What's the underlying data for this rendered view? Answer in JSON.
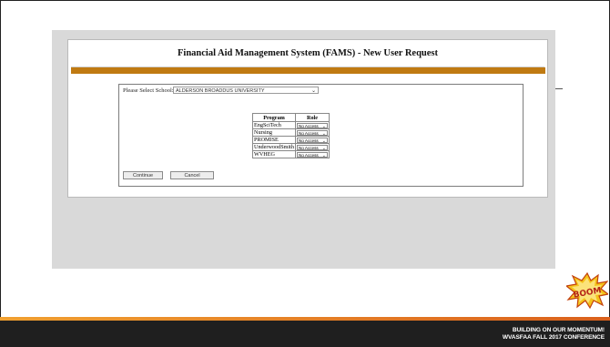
{
  "app": {
    "title": "Financial Aid Management System (FAMS) - New User Request"
  },
  "form": {
    "school_label": "Please Select School:",
    "school_selected": "ALDERSON BROADDUS UNIVERSITY",
    "table": {
      "headers": [
        "Program",
        "Role"
      ],
      "rows": [
        {
          "program": "EngSciTech",
          "role": "No Access"
        },
        {
          "program": "Nursing",
          "role": "No Access"
        },
        {
          "program": "PROMISE",
          "role": "No Access"
        },
        {
          "program": "UnderwoodSmith",
          "role": "No Access"
        },
        {
          "program": "WVHEG",
          "role": "No Access"
        }
      ]
    },
    "continue_label": "Continue",
    "cancel_label": "Cancel"
  },
  "footer": {
    "line1": "BUILDING ON OUR MOMENTUM!",
    "line2": "WVASFAA FALL 2017 CONFERENCE",
    "badge_text": "BOOM",
    "accent_colors": [
      "#f0a030",
      "#d9601c"
    ]
  },
  "colors": {
    "header_bar": "#c07a12",
    "panel_bg": "#d9d9d9",
    "footer_bg": "#1f1f1f"
  }
}
